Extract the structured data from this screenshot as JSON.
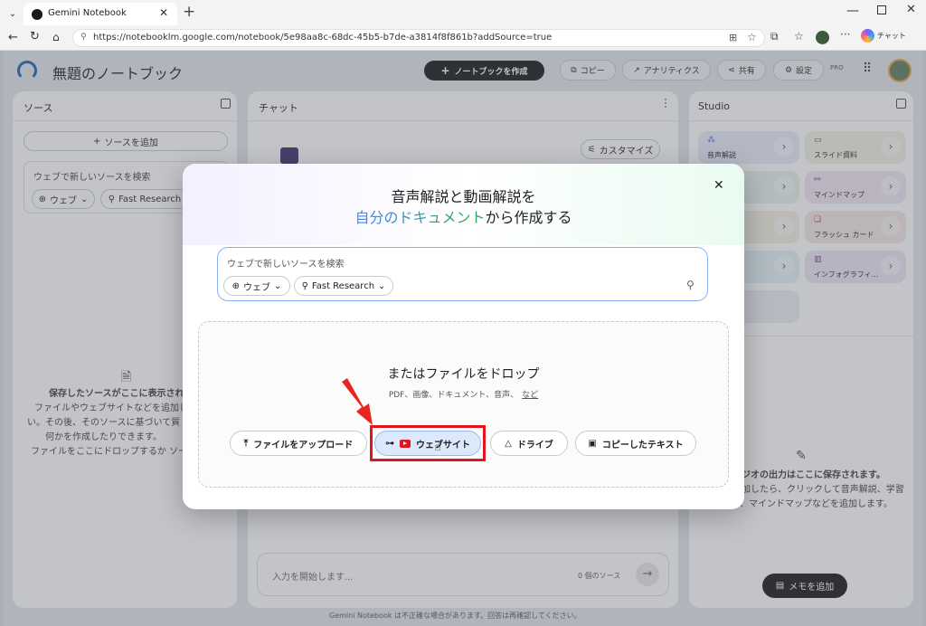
{
  "browser": {
    "tab_title": "Gemini Notebook",
    "url": "https://notebooklm.google.com/notebook/5e98aa8c-68dc-45b5-b7de-a3814f8f861b?addSource=true",
    "profile_label": "チャット"
  },
  "header": {
    "notebook_title": "無題のノートブック",
    "create_button": "ノートブックを作成",
    "copy_button": "コピー",
    "analytics_button": "アナリティクス",
    "share_button": "共有",
    "settings_button": "設定",
    "pro_badge": "PRO"
  },
  "source_panel": {
    "title": "ソース",
    "add_button": "ソースを追加",
    "search_placeholder": "ウェブで新しいソースを検索",
    "web_chip": "ウェブ",
    "research_chip": "Fast Research",
    "empty_title": "保存したソースがここに表示され",
    "empty_line1": "ファイルやウェブサイトなどを追加し",
    "empty_line2": "い。その後、そのソースに基づいて質",
    "empty_line3": "何かを作成したりできます。",
    "empty_line4": "ファイルをここにドロップするか ソー"
  },
  "chat_panel": {
    "title": "チャット",
    "customize_button": "カスタマイズ",
    "input_placeholder": "入力を開始します...",
    "source_count": "0 個のソース"
  },
  "studio_panel": {
    "title": "Studio",
    "cards": [
      "音声解説",
      "スライド資料",
      "マインドマップ",
      "フラッシュ カード",
      "インフォグラフィ…"
    ],
    "empty_title": "ジオの出力はここに保存されます。",
    "empty_line1": "加したら、クリックして音声解説、学習",
    "empty_line2": "、マインドマップなどを追加します。",
    "add_note_button": "メモを追加"
  },
  "footer": {
    "disclaimer": "Gemini Notebook は不正確な場合があります。回答は再確認してください。"
  },
  "modal": {
    "heading_line1": "音声解説と動画解説を",
    "heading_line2_highlight": "自分のドキュメント",
    "heading_line2_rest": "から作成する",
    "search_placeholder": "ウェブで新しいソースを検索",
    "web_chip": "ウェブ",
    "research_chip": "Fast Research",
    "drop_title": "またはファイルをドロップ",
    "drop_sub": "PDF、画像、ドキュメント、音声、",
    "drop_more_link": "など",
    "upload_button": "ファイルをアップロード",
    "website_button": "ウェブサイト",
    "drive_button": "ドライブ",
    "copied_text_button": "コピーしたテキスト"
  },
  "colors": {
    "accent_gradient_start": "#4285f4",
    "accent_gradient_end": "#34a853",
    "highlight_box": "#e0141d",
    "arrow": "#e8261f",
    "primary_dark": "#121212"
  }
}
